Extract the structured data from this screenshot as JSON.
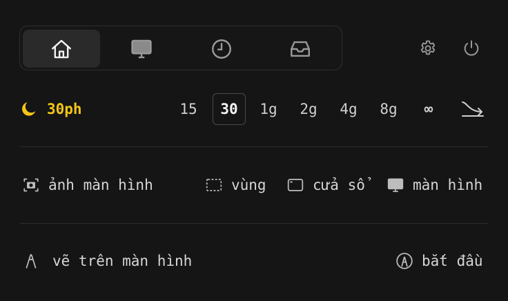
{
  "tabs": [
    {
      "icon": "home-icon",
      "active": true
    },
    {
      "icon": "monitor-icon",
      "active": false
    },
    {
      "icon": "clock-icon",
      "active": false
    },
    {
      "icon": "inbox-icon",
      "active": false
    }
  ],
  "header_icons": [
    "settings-icon",
    "power-icon"
  ],
  "duration": {
    "label": "30ph",
    "accent": "#f5c518",
    "options": [
      "15",
      "30",
      "1g",
      "2g",
      "4g",
      "8g",
      "∞"
    ],
    "selected": "30",
    "extra_icon": "downtrend-arrow-icon"
  },
  "capture": {
    "screenshot_label": "ảnh màn hình",
    "region_label": "vùng",
    "window_label": "cửa sổ",
    "screen_label": "màn hình"
  },
  "draw": {
    "label": "vẽ trên màn hình",
    "start_label": "bắt đầu"
  }
}
